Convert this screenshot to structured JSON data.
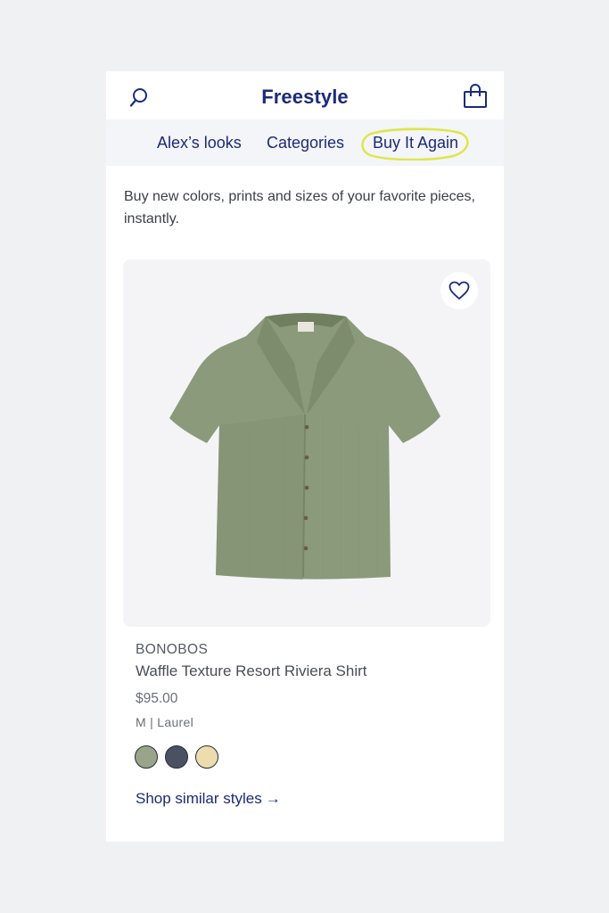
{
  "header": {
    "title": "Freestyle",
    "search_icon": "search-icon",
    "bag_icon": "shopping-bag-icon"
  },
  "tabs": [
    {
      "label": "Alex’s looks"
    },
    {
      "label": "Categories"
    },
    {
      "label": "Buy It Again",
      "highlighted": true
    }
  ],
  "intro": {
    "text": "Buy new colors, prints and sizes of your favorite pieces, instantly."
  },
  "product": {
    "brand": "BONOBOS",
    "name": "Waffle Texture Resort Riviera Shirt",
    "price": "$95.00",
    "variant": "M | Laurel",
    "favorite_icon": "heart-icon",
    "swatches": [
      {
        "name": "laurel",
        "color": "#9aa48a"
      },
      {
        "name": "navy",
        "color": "#4a5163"
      },
      {
        "name": "sand",
        "color": "#ecdcae"
      }
    ],
    "shop_similar": "Shop similar styles",
    "arrow_icon": "arrow-right-icon"
  },
  "colors": {
    "brand": "#1b2a7b",
    "highlight": "#dde64a",
    "background": "#f0f1f2",
    "card_bg": "#f4f4f7",
    "shirt": "#8a9a7a"
  }
}
